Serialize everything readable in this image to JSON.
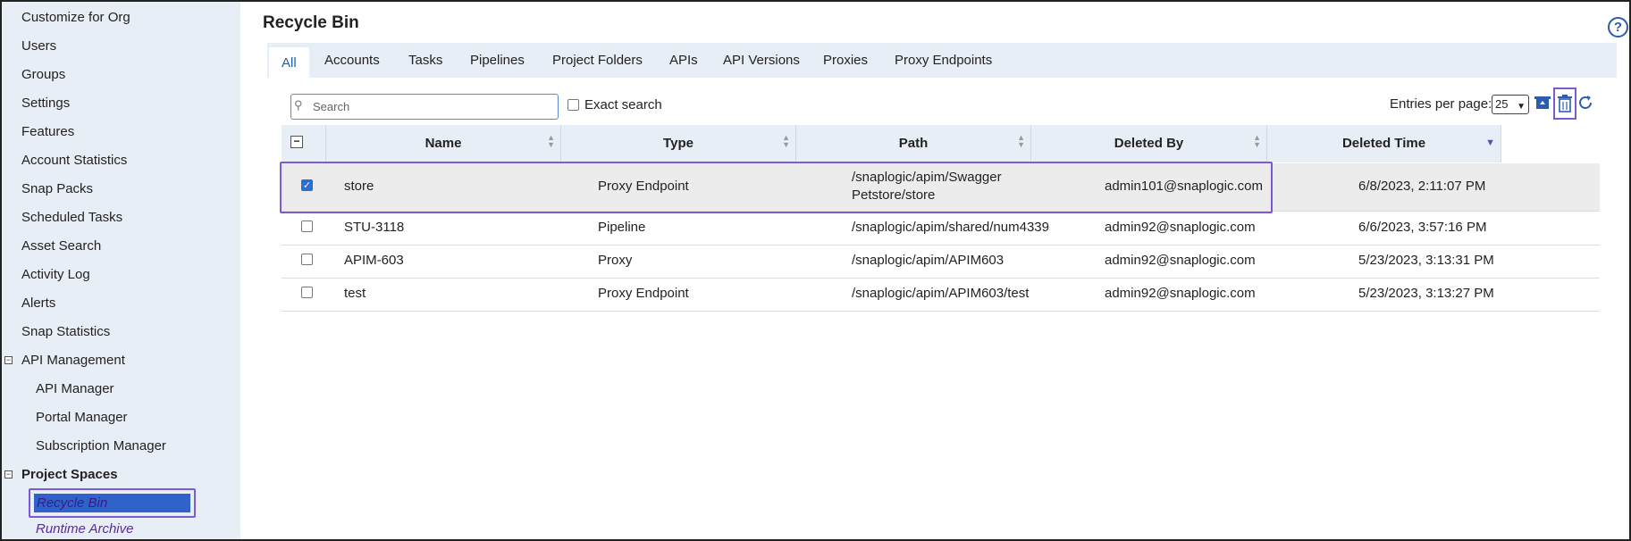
{
  "sidebar": {
    "items": [
      {
        "label": "Customize for Org"
      },
      {
        "label": "Users"
      },
      {
        "label": "Groups"
      },
      {
        "label": "Settings"
      },
      {
        "label": "Features"
      },
      {
        "label": "Account Statistics"
      },
      {
        "label": "Snap Packs"
      },
      {
        "label": "Scheduled Tasks"
      },
      {
        "label": "Asset Search"
      },
      {
        "label": "Activity Log"
      },
      {
        "label": "Alerts"
      },
      {
        "label": "Snap Statistics"
      }
    ],
    "api_management": {
      "label": "API Management",
      "children": [
        {
          "label": "API Manager"
        },
        {
          "label": "Portal Manager"
        },
        {
          "label": "Subscription Manager"
        }
      ]
    },
    "project_spaces": {
      "label": "Project Spaces",
      "children": [
        {
          "label": "Recycle Bin"
        },
        {
          "label": "Runtime Archive"
        }
      ]
    }
  },
  "page": {
    "title": "Recycle Bin",
    "help_icon": "?"
  },
  "tabs": [
    {
      "label": "All",
      "active": true
    },
    {
      "label": "Accounts"
    },
    {
      "label": "Tasks"
    },
    {
      "label": "Pipelines"
    },
    {
      "label": "Project Folders"
    },
    {
      "label": "APIs"
    },
    {
      "label": "API Versions"
    },
    {
      "label": "Proxies"
    },
    {
      "label": "Proxy Endpoints"
    }
  ],
  "search": {
    "placeholder": "Search",
    "exact_label": "Exact search"
  },
  "toolbar": {
    "entries_label": "Entries per page:",
    "entries_value": "25",
    "icons": [
      "restore-icon",
      "delete-icon",
      "refresh-icon"
    ]
  },
  "table": {
    "columns": [
      "Name",
      "Type",
      "Path",
      "Deleted By",
      "Deleted Time"
    ],
    "sorted_column": "Deleted Time",
    "sort_direction": "desc",
    "rows": [
      {
        "name": "store",
        "type": "Proxy Endpoint",
        "path_line1": "/snaplogic/apim/Swagger",
        "path_line2": "Petstore/store",
        "deleted_by": "admin101@snaplogic.com",
        "deleted_time": "6/8/2023, 2:11:07 PM",
        "checked": true
      },
      {
        "name": "STU-3118",
        "type": "Pipeline",
        "path_line1": "/snaplogic/apim/shared/num4339",
        "path_line2": "",
        "deleted_by": "admin92@snaplogic.com",
        "deleted_time": "6/6/2023, 3:57:16 PM",
        "checked": false
      },
      {
        "name": "APIM-603",
        "type": "Proxy",
        "path_line1": "/snaplogic/apim/APIM603",
        "path_line2": "",
        "deleted_by": "admin92@snaplogic.com",
        "deleted_time": "5/23/2023, 3:13:31 PM",
        "checked": false
      },
      {
        "name": "test",
        "type": "Proxy Endpoint",
        "path_line1": "/snaplogic/apim/APIM603/test",
        "path_line2": "",
        "deleted_by": "admin92@snaplogic.com",
        "deleted_time": "5/23/2023, 3:13:27 PM",
        "checked": false
      }
    ]
  },
  "colors": {
    "accent": "#2a5db0",
    "highlight": "#7b5ad6",
    "sidebar_bg": "#e8eef5",
    "selected_nav": "#2f63c9"
  }
}
